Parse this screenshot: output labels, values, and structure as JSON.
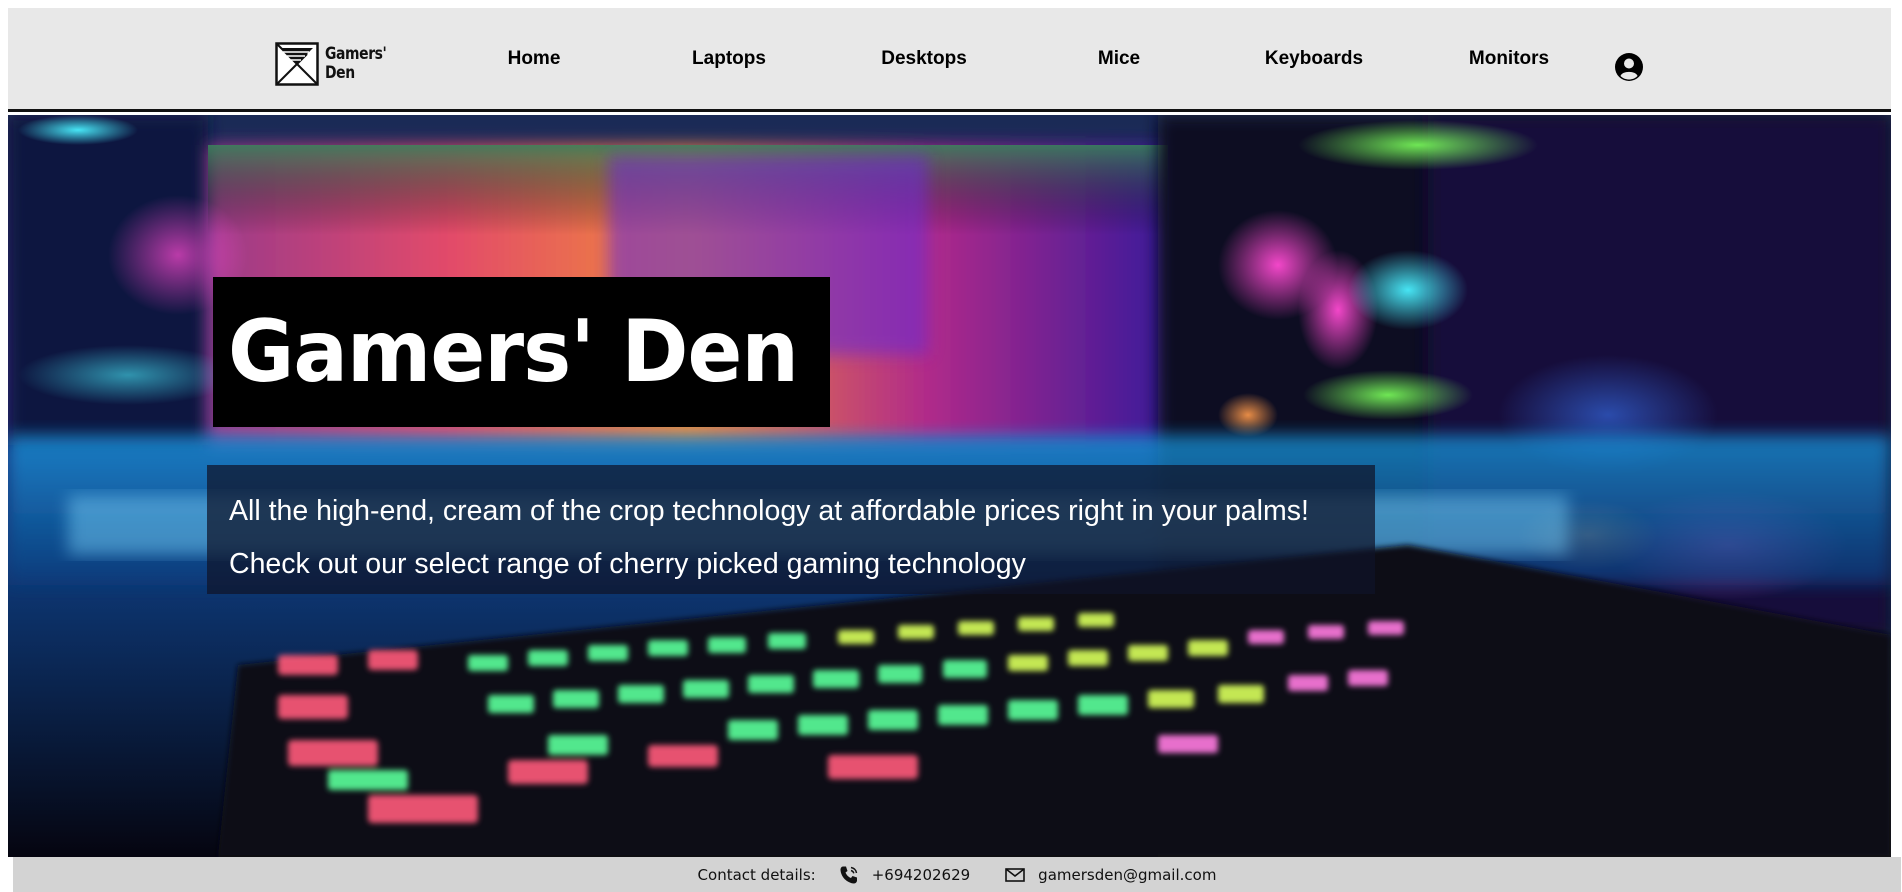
{
  "nav": {
    "logo_text": "Gamers'\nDen",
    "links": [
      {
        "label": "Home"
      },
      {
        "label": "Laptops"
      },
      {
        "label": "Desktops"
      },
      {
        "label": "Mice"
      },
      {
        "label": "Keyboards"
      },
      {
        "label": "Monitors"
      }
    ],
    "account_icon": "user-circle-icon"
  },
  "hero": {
    "title": "Gamers' Den",
    "tagline_1": "All the high-end, cream of the crop technology at affordable prices right in your palms!",
    "tagline_2": "Check out our select range of cherry picked gaming technology",
    "background_image": "blurred-rgb-gaming-keyboard-photo"
  },
  "footer": {
    "label": "Contact details:",
    "phone": "+694202629",
    "phone_icon": "phone-icon",
    "email": "gamersden@gmail.com",
    "email_icon": "mail-icon"
  },
  "colors": {
    "navbar_bg": "#e8e8e8",
    "footer_bg": "#d3d3d3",
    "title_box_bg": "#000000",
    "tagline_box_bg": "rgba(15,20,40,0.72)"
  }
}
